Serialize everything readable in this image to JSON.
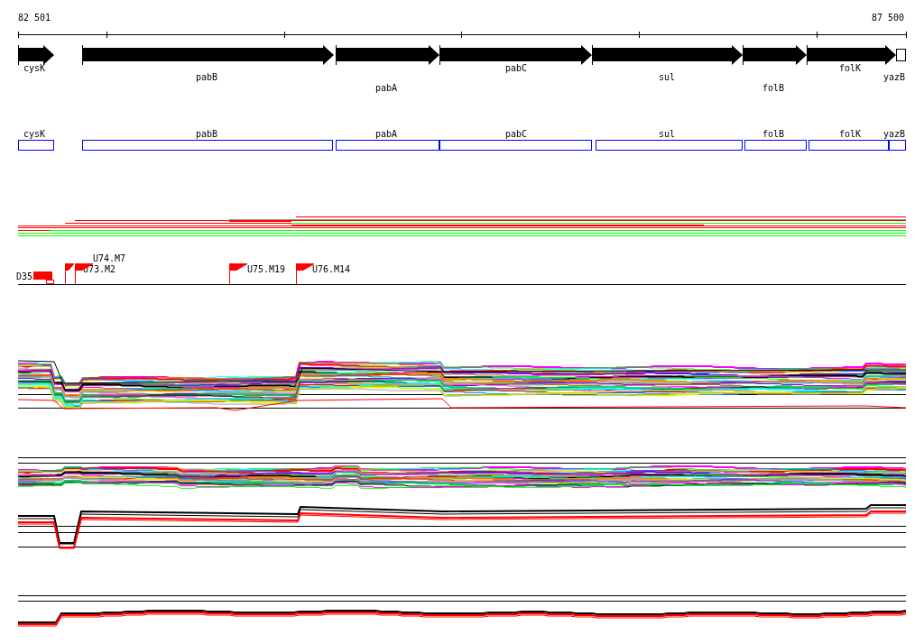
{
  "ruler": {
    "start": "82 501",
    "end": "87 500"
  },
  "gene_arrows": [
    {
      "name": "cysK",
      "kind": "arrow"
    },
    {
      "name": "pabB",
      "kind": "arrow"
    },
    {
      "name": "pabA",
      "kind": "arrow"
    },
    {
      "name": "pabC",
      "kind": "arrow"
    },
    {
      "name": "sul",
      "kind": "arrow"
    },
    {
      "name": "folB",
      "kind": "arrow"
    },
    {
      "name": "folK",
      "kind": "arrow"
    },
    {
      "name": "yazB",
      "kind": "outline"
    }
  ],
  "gene_boxes": [
    {
      "name": "cysK"
    },
    {
      "name": "pabB"
    },
    {
      "name": "pabA"
    },
    {
      "name": "pabC"
    },
    {
      "name": "sul"
    },
    {
      "name": "folB"
    },
    {
      "name": "folK"
    },
    {
      "name": "yazB"
    }
  ],
  "markers": [
    {
      "label": "D35",
      "kind": "block"
    },
    {
      "label": "U73.M2",
      "kind": "flag"
    },
    {
      "label": "U74.M7",
      "kind": "flag"
    },
    {
      "label": "U75.M19",
      "kind": "flag"
    },
    {
      "label": "U76.M14",
      "kind": "flag"
    }
  ]
}
